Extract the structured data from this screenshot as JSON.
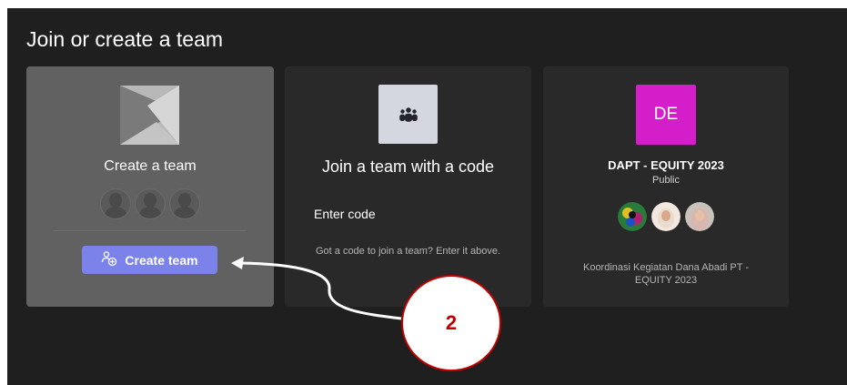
{
  "header": {
    "title": "Join or create a team"
  },
  "create_card": {
    "title": "Create a team",
    "button_label": "Create team"
  },
  "join_card": {
    "title": "Join a team with a code",
    "input_placeholder": "Enter code",
    "hint": "Got a code to join a team? Enter it above."
  },
  "team_card": {
    "initials": "DE",
    "name": "DAPT - EQUITY 2023",
    "visibility": "Public",
    "description": "Koordinasi Kegiatan Dana Abadi PT - EQUITY 2023",
    "tile_color": "#d31ec9"
  },
  "annotation": {
    "label": "2"
  },
  "colors": {
    "accent": "#7b83eb",
    "callout": "#c00000"
  }
}
